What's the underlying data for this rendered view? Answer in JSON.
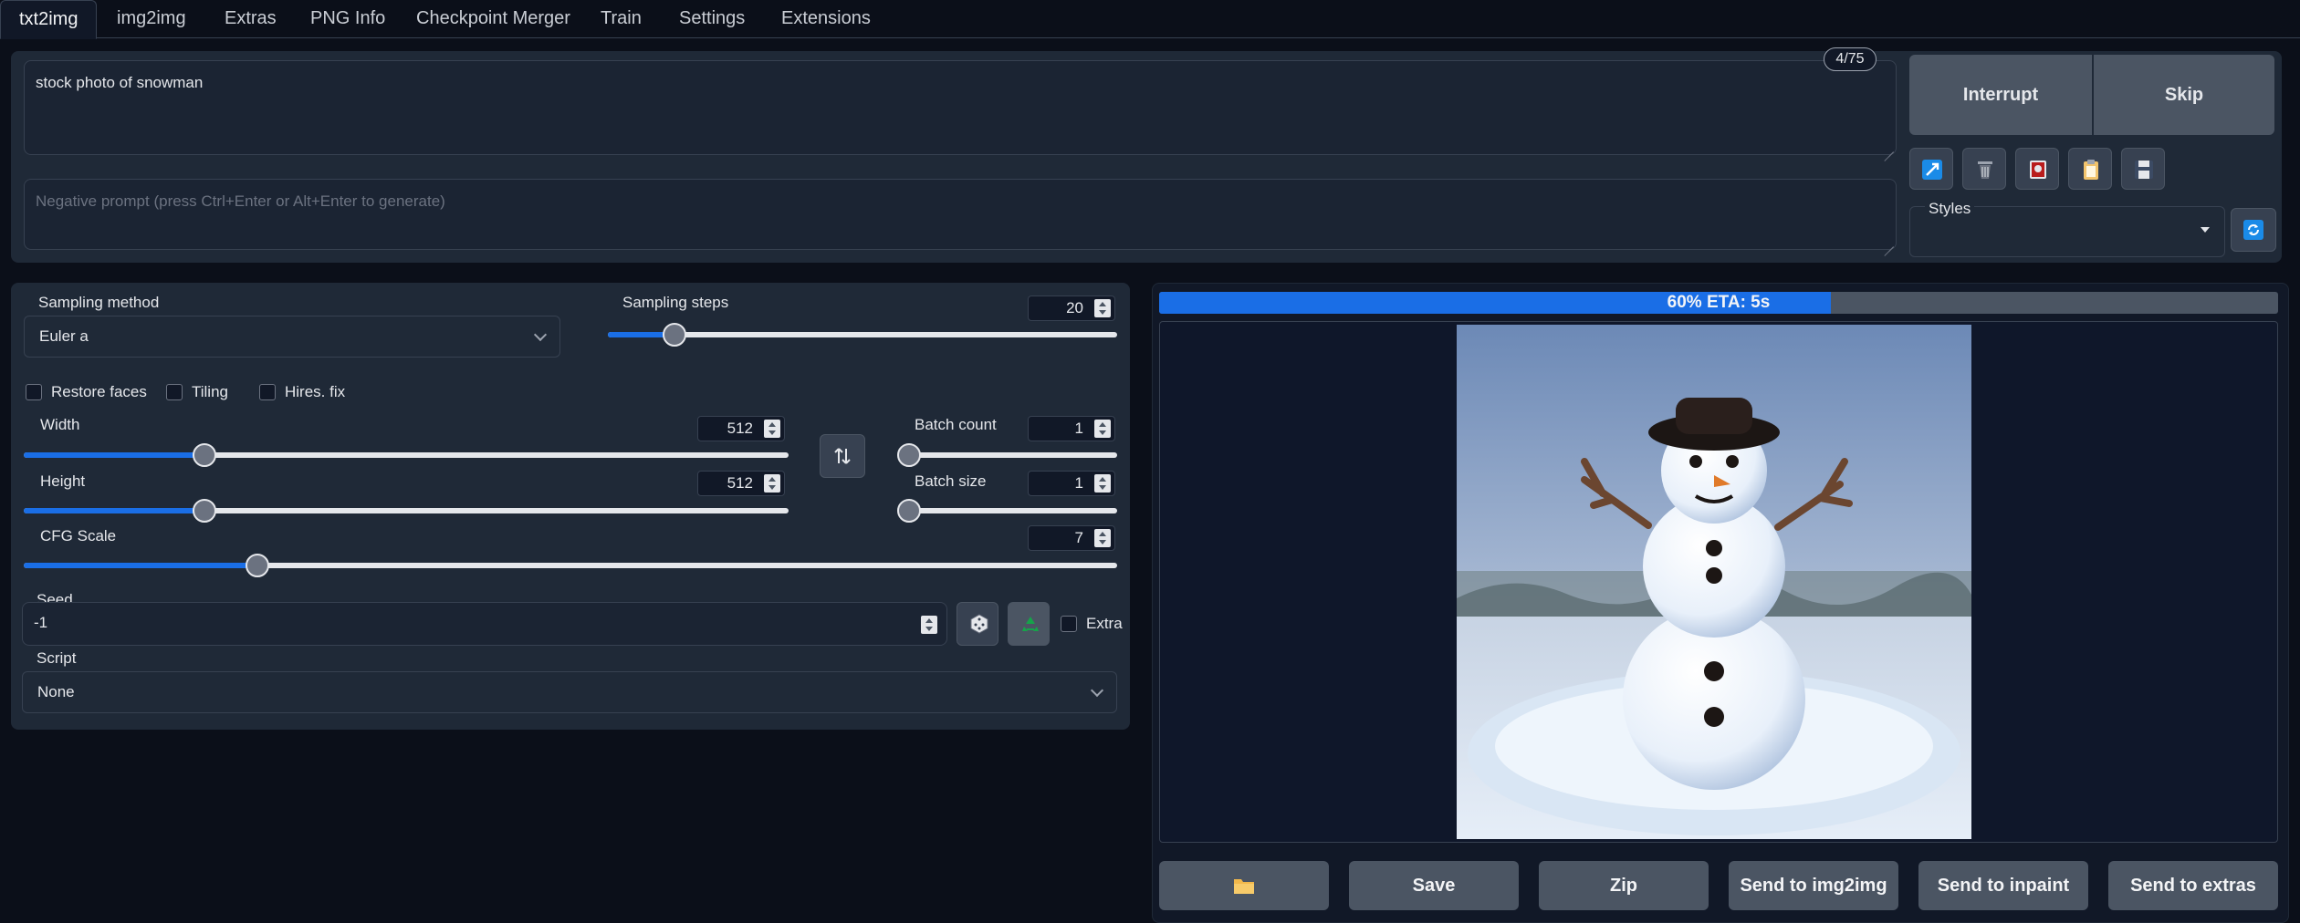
{
  "tabs": [
    {
      "label": "txt2img",
      "active": true
    },
    {
      "label": "img2img"
    },
    {
      "label": "Extras"
    },
    {
      "label": "PNG Info"
    },
    {
      "label": "Checkpoint Merger"
    },
    {
      "label": "Train"
    },
    {
      "label": "Settings"
    },
    {
      "label": "Extensions"
    }
  ],
  "prompt": {
    "value": "stock photo of snowman",
    "token_count": "4/75",
    "negative_placeholder": "Negative prompt (press Ctrl+Enter or Alt+Enter to generate)"
  },
  "actions": {
    "interrupt": "Interrupt",
    "skip": "Skip"
  },
  "tool_icons": [
    "read-params-icon",
    "trash-icon",
    "paste-icon",
    "clipboard-icon",
    "save-style-icon"
  ],
  "styles": {
    "label": "Styles",
    "value": "",
    "refresh_icon": "refresh-icon"
  },
  "settings": {
    "sampling_method": {
      "label": "Sampling method",
      "value": "Euler a"
    },
    "sampling_steps": {
      "label": "Sampling steps",
      "value": "20",
      "fraction": 0.13
    },
    "restore_faces": "Restore faces",
    "tiling": "Tiling",
    "hires_fix": "Hires. fix",
    "width": {
      "label": "Width",
      "value": "512",
      "fraction": 0.236
    },
    "height": {
      "label": "Height",
      "value": "512",
      "fraction": 0.236
    },
    "batch_count": {
      "label": "Batch count",
      "value": "1",
      "fraction": 0
    },
    "batch_size": {
      "label": "Batch size",
      "value": "1",
      "fraction": 0
    },
    "cfg_scale": {
      "label": "CFG Scale",
      "value": "7",
      "fraction": 0.214
    },
    "seed": {
      "label": "Seed",
      "value": "-1",
      "extra": "Extra"
    },
    "script": {
      "label": "Script",
      "value": "None"
    }
  },
  "progress": {
    "text": "60% ETA: 5s",
    "fraction": 0.6
  },
  "output_buttons": {
    "folder_icon": "folder-icon",
    "save": "Save",
    "zip": "Zip",
    "send_img2img": "Send to img2img",
    "send_inpaint": "Send to inpaint",
    "send_extras": "Send to extras"
  },
  "colors": {
    "accent": "#1a6ee6",
    "background": "#0b0f19",
    "panel": "#1f2937"
  }
}
